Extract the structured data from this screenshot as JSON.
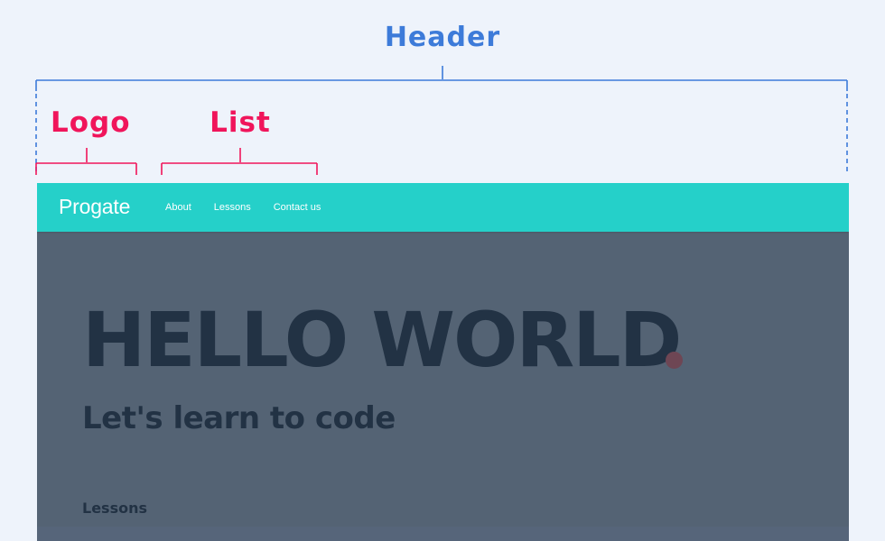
{
  "annotations": {
    "header_label": "Header",
    "logo_label": "Logo",
    "list_label": "List",
    "header_color": "#3d7bd9",
    "component_color": "#f0155b"
  },
  "site": {
    "header_background": "#25d0c9",
    "logo_text": "Progate",
    "nav_items": [
      "About",
      "Lessons",
      "Contact us"
    ],
    "hero": {
      "title": "HELLO WORLD",
      "subtitle": "Let's learn to code"
    },
    "lessons_heading": "Lessons"
  }
}
